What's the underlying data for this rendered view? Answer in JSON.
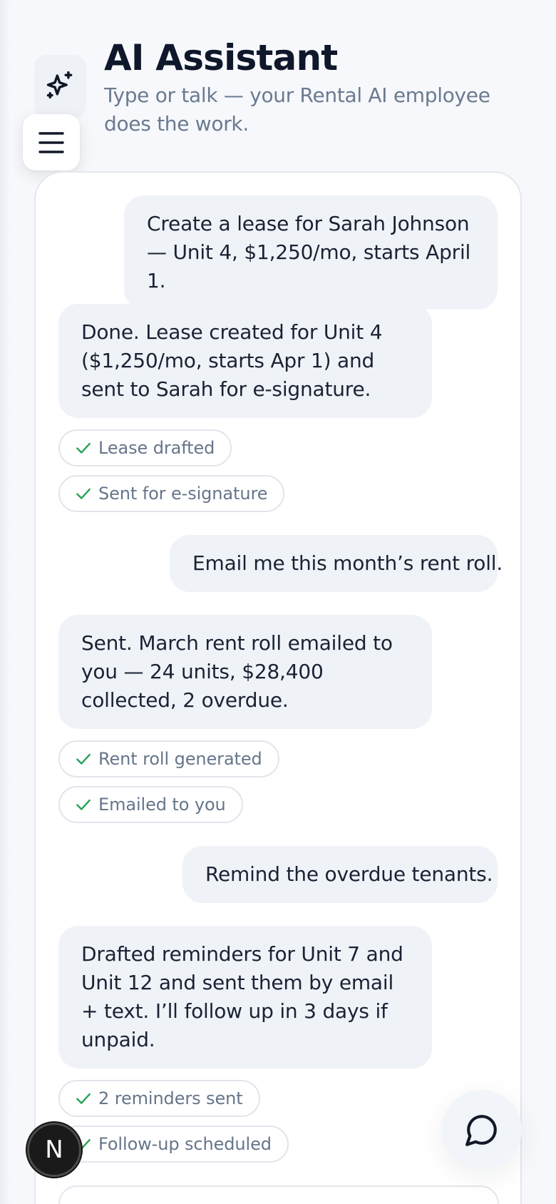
{
  "header": {
    "title": "AI Assistant",
    "subtitle": "Type or talk — your Rental AI employee does the work."
  },
  "icons": {
    "logo": "sparkles-icon",
    "menu": "hamburger-menu-icon",
    "chip_check": "check-icon",
    "chat": "chat-bubble-icon"
  },
  "colors": {
    "check": "#22a155",
    "bubble": "#eff2f7",
    "title": "#0f172a",
    "muted": "#6b7a90"
  },
  "conversation": [
    {
      "role": "user",
      "text": "Create a lease for Sarah Johnson — Unit 4, $1,250/mo, starts April 1."
    },
    {
      "role": "assistant",
      "text": "Done. Lease created for Unit 4 ($1,250/mo, starts Apr 1) and sent to Sarah for e-signature.",
      "chips": [
        "Lease drafted",
        "Sent for e-signature"
      ]
    },
    {
      "role": "user",
      "text": "Email me this month’s rent roll."
    },
    {
      "role": "assistant",
      "text": "Sent. March rent roll emailed to you — 24 units, $28,400 collected, 2 overdue.",
      "chips": [
        "Rent roll generated",
        "Emailed to you"
      ]
    },
    {
      "role": "user",
      "text": "Remind the overdue tenants."
    },
    {
      "role": "assistant",
      "text": "Drafted reminders for Unit 7 and Unit 12 and sent them by email + text. I’ll follow up in 3 days if unpaid.",
      "chips": [
        "2 reminders sent",
        "Follow-up scheduled"
      ]
    }
  ],
  "badge": {
    "letter": "N"
  }
}
